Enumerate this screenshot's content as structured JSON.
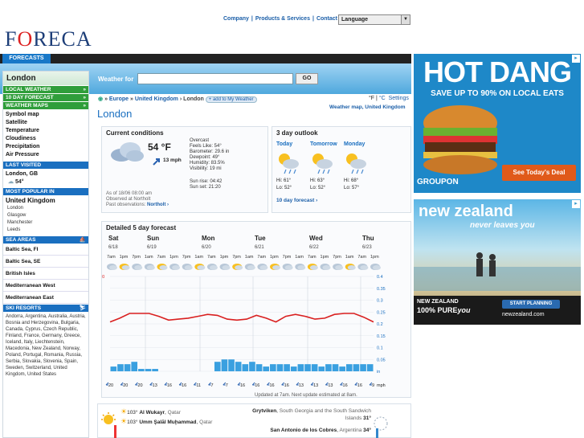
{
  "topnav": {
    "company": "Company",
    "sep1": "|",
    "products": "Products & Services",
    "sep2": "|",
    "contact": "Contact",
    "language": "Language"
  },
  "logo": {
    "pre": "F",
    "o": "O",
    "post": "RECA"
  },
  "forecasts_tab": "FORECASTS",
  "left": {
    "city": "London",
    "local_weather": "LOCAL WEATHER",
    "ten_day": "10 DAY FORECAST",
    "weather_maps": "WEATHER MAPS",
    "map_items": [
      "Symbol map",
      "Satellite",
      "Temperature",
      "Cloudiness",
      "Precipitation",
      "Air Pressure"
    ],
    "last_visited": "LAST VISITED",
    "last_city": "London, GB",
    "last_temp": "54°",
    "most_popular": "MOST POPULAR IN",
    "popular_country": "United Kingdom",
    "popular_cities": [
      "London",
      "Glasgow",
      "Manchester",
      "Leeds"
    ],
    "sea_areas": "SEA AREAS",
    "seas": [
      "Baltic Sea, FI",
      "Baltic Sea, SE",
      "British Isles",
      "Mediterranean West",
      "Mediterranean East"
    ],
    "ski_resorts": "SKI RESORTS",
    "ski_list": "Andorra, Argentina, Australia, Austria, Bosnia and Herzegovina, Bulgaria, Canada, Cyprus, Czech Republic, Finland, France, Germany, Greece, Iceland, Italy, Liechtenstein, Macedonia, New Zealand, Norway, Poland, Portugal, Romania, Russia, Serbia, Slovakia, Slovenia, Spain, Sweden, Switzerland, United Kingdom, United States",
    "chevron": "»"
  },
  "search": {
    "label": "Weather for",
    "go": "GO"
  },
  "crumb": {
    "europe": "Europe",
    "uk": "United Kingdom",
    "london": "London",
    "add": "+ add to My Weather",
    "arrows": "»"
  },
  "units": {
    "f": "°F",
    "c": "°C",
    "settings": "Settings",
    "sep": "|"
  },
  "weather_map_link": "Weather map, United Kingdom",
  "city_heading": "London",
  "current": {
    "title": "Current conditions",
    "temp": "54 °F",
    "wind": "13 mph",
    "details": [
      "Overcast",
      "Feels Like: 54°",
      "Barometer: 29.6 in",
      "Dewpoint: 49°",
      "Humidity: 83.5%",
      "Visibility: 19 mi"
    ],
    "sunrise": "Sun rise: 04:42",
    "sunset": "Sun set: 21:20",
    "asof": "As of 18/06 08:00 am",
    "observed": "Observed at Northolt",
    "past": "Past observations: ",
    "past_link": "Northolt ›"
  },
  "outlook": {
    "title": "3 day outlook",
    "days": [
      {
        "name": "Today",
        "hi": "Hi: 61°",
        "lo": "Lo: 52°"
      },
      {
        "name": "Tomorrow",
        "hi": "Hi: 63°",
        "lo": "Lo: 52°"
      },
      {
        "name": "Monday",
        "hi": "Hi: 68°",
        "lo": "Lo: 57°"
      }
    ],
    "link": "10 day forecast ›"
  },
  "five_day": {
    "title": "Detailed 5 day forecast",
    "days": [
      {
        "name": "Sat",
        "date": "6/18"
      },
      {
        "name": "Sun",
        "date": "6/19"
      },
      {
        "name": "Mon",
        "date": "6/20"
      },
      {
        "name": "Tue",
        "date": "6/21"
      },
      {
        "name": "Wed",
        "date": "6/22"
      },
      {
        "name": "Thu",
        "date": "6/23"
      }
    ],
    "hours": [
      "7am",
      "1pm",
      "7pm",
      "1am",
      "7am",
      "1pm",
      "7pm",
      "1am",
      "7am",
      "1pm",
      "7pm",
      "1am",
      "7am",
      "1pm",
      "7pm",
      "1am",
      "7am",
      "1pm",
      "7pm",
      "1am",
      "7am",
      "1pm"
    ],
    "winds": [
      "20",
      "20",
      "20",
      "13",
      "16",
      "16",
      "11",
      "7",
      "7",
      "16",
      "16",
      "16",
      "16",
      "13",
      "13",
      "13",
      "16",
      "16",
      "9"
    ],
    "mph": "mph",
    "updated": "Updated at 7am. Next update estimated at 8am.",
    "left_ticks": [
      "100",
      "90",
      "80",
      "70",
      "60",
      "50",
      "40",
      "30",
      "20",
      "°F"
    ],
    "right_ticks": [
      "0.4",
      "0.35",
      "0.3",
      "0.25",
      "0.2",
      "0.15",
      "0.1",
      "0.05",
      "in"
    ]
  },
  "chart_data": {
    "type": "line",
    "title": "Detailed 5 day forecast",
    "ylim": [
      0,
      100
    ],
    "y2lim": [
      0,
      0.4
    ],
    "series": [
      {
        "values": [
          52,
          56,
          61,
          61,
          61,
          58,
          54,
          55,
          56,
          58,
          60,
          59,
          55,
          54,
          55,
          59,
          56,
          52,
          58,
          60,
          58,
          55,
          56,
          60,
          61,
          61,
          57,
          52
        ]
      },
      {
        "axis": "right",
        "values": [
          0.02,
          0.03,
          0.03,
          0.04,
          0.01,
          0.01,
          0.01,
          0.0,
          0.0,
          0.0,
          0.0,
          0.0,
          0.0,
          0.0,
          0.0,
          0.04,
          0.05,
          0.05,
          0.04,
          0.03,
          0.04,
          0.03,
          0.02,
          0.03,
          0.03,
          0.03,
          0.02,
          0.03,
          0.03,
          0.03,
          0.02,
          0.03,
          0.03,
          0.02,
          0.03,
          0.03,
          0.03,
          0.03
        ]
      }
    ]
  },
  "extremes": [
    {
      "temp": "103°",
      "place": "Al Wukayr",
      "country": "Qatar"
    },
    {
      "temp": "103°",
      "place": "Umm Şalāl Muḩammad",
      "country": "Qatar"
    },
    {
      "place": "Grytviken",
      "country": "South Georgia and the South Sandwich Islands",
      "temp": "31°"
    },
    {
      "place": "San Antonio de los Cobres",
      "country": "Argentina",
      "temp": "34°"
    }
  ],
  "ad1": {
    "line1": "HOT DANG",
    "line2": "SAVE UP TO 90% ON LOCAL EATS",
    "brand": "GROUPON",
    "cta": "See Today's Deal"
  },
  "ad2": {
    "line1": "new zealand",
    "line2": "never leaves you",
    "brand1": "NEW ZEALAND",
    "brand2": "100% PURE",
    "brand3": "you",
    "cta": "START PLANNING",
    "url": "newzealand.com"
  },
  "colors": {
    "green": "#2f9e3a",
    "blue": "#1a6fc0",
    "temp_line": "#d92020",
    "precip": "#3aa0e0"
  }
}
